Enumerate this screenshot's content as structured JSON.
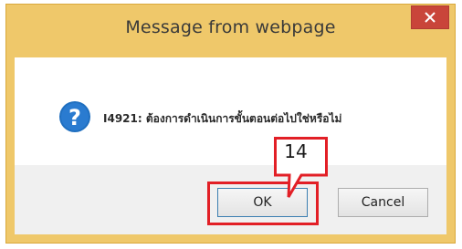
{
  "dialog": {
    "title": "Message from webpage",
    "close_icon": "close-icon",
    "message_icon": "question-icon",
    "message": "I4921: ต้องการดำเนินการขั้นตอนต่อไปใช่หรือไม่",
    "ok_label": "OK",
    "cancel_label": "Cancel"
  },
  "annotation": {
    "step_number": "14"
  },
  "colors": {
    "frame": "#efc86a",
    "close_button": "#c9453a",
    "highlight": "#e21f26",
    "question_icon": "#1f6fc0"
  }
}
